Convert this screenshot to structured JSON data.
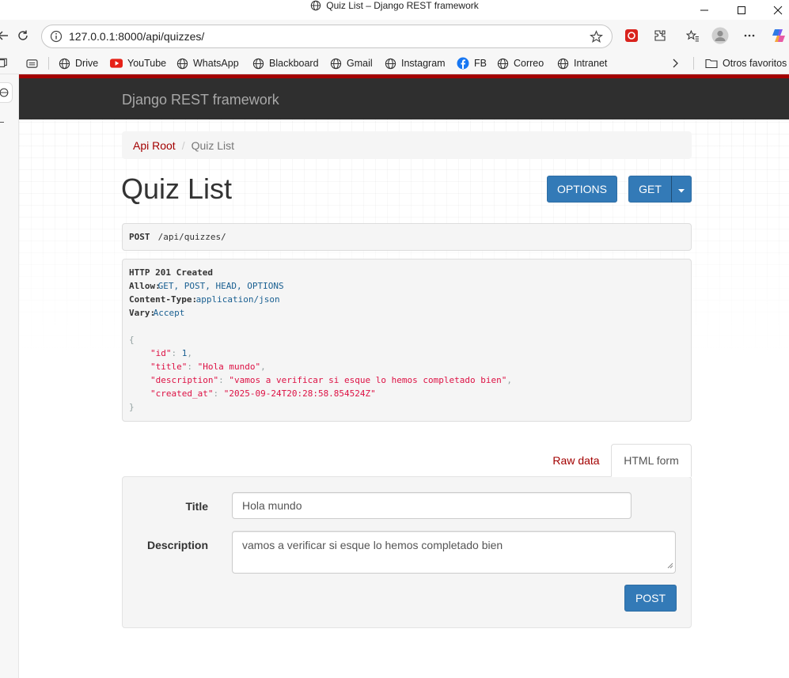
{
  "window": {
    "title": "Quiz List – Django REST framework"
  },
  "browser": {
    "url": "127.0.0.1:8000/api/quizzes/",
    "bookmarks": [
      {
        "label": "Drive",
        "icon": "globe-icon"
      },
      {
        "label": "YouTube",
        "icon": "youtube-icon"
      },
      {
        "label": "WhatsApp",
        "icon": "globe-icon"
      },
      {
        "label": "Blackboard",
        "icon": "globe-icon"
      },
      {
        "label": "Gmail",
        "icon": "globe-icon"
      },
      {
        "label": "Instagram",
        "icon": "globe-icon"
      },
      {
        "label": "FB",
        "icon": "facebook-icon"
      },
      {
        "label": "Correo",
        "icon": "globe-icon"
      },
      {
        "label": "Intranet",
        "icon": "globe-icon"
      }
    ],
    "other_favorites": "Otros favoritos"
  },
  "navbar": {
    "brand": "Django REST framework"
  },
  "breadcrumb": {
    "root": "Api Root",
    "separator": "/",
    "current": "Quiz List"
  },
  "page": {
    "title": "Quiz List",
    "options_button": "OPTIONS",
    "get_button": "GET"
  },
  "request": {
    "method": "POST",
    "path": " /api/quizzes/"
  },
  "response": {
    "status": "HTTP 201 Created",
    "headers": [
      {
        "name": "Allow:",
        "value": " GET, POST, HEAD, OPTIONS"
      },
      {
        "name": "Content-Type:",
        "value": " application/json"
      },
      {
        "name": "Vary:",
        "value": " Accept"
      }
    ],
    "open_brace": "{",
    "close_brace": "}",
    "fields": [
      {
        "key": "\"id\"",
        "value": "1",
        "kind": "num"
      },
      {
        "key": "\"title\"",
        "value": "\"Hola mundo\"",
        "kind": "str"
      },
      {
        "key": "\"description\"",
        "value": "\"vamos a verificar si esque lo hemos completado bien\"",
        "kind": "str"
      },
      {
        "key": "\"created_at\"",
        "value": "\"2025-09-24T20:28:58.854524Z\"",
        "kind": "str"
      }
    ]
  },
  "form_tabs": {
    "raw": "Raw data",
    "html": "HTML form"
  },
  "form": {
    "title_label": "Title",
    "title_value": "Hola mundo",
    "description_label": "Description",
    "description_value": "vamos a verificar si esque lo hemos completado bien",
    "submit": "POST"
  },
  "colors": {
    "accent": "#a30000",
    "primary": "#337ab7",
    "navbar": "#2f2f2f"
  }
}
